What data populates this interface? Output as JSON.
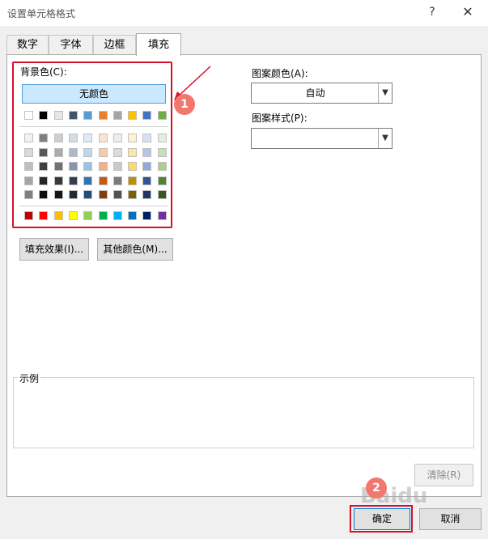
{
  "window": {
    "title": "设置单元格格式",
    "help_label": "?",
    "close_label": "✕"
  },
  "tabs": [
    {
      "label": "数字"
    },
    {
      "label": "字体"
    },
    {
      "label": "边框"
    },
    {
      "label": "填充"
    }
  ],
  "fill": {
    "bg_label": "背景色(C):",
    "no_color_label": "无颜色",
    "theme_row": [
      "#ffffff",
      "#000000",
      "#e7e6e6",
      "#44546a",
      "#5b9bd5",
      "#ed7d31",
      "#a5a5a5",
      "#ffc000",
      "#4472c4",
      "#70ad47"
    ],
    "shade_rows": [
      [
        "#f2f2f2",
        "#7f7f7f",
        "#d0cece",
        "#d6dce4",
        "#ddebf7",
        "#fbe4d5",
        "#ededed",
        "#fff2cc",
        "#d9e1f2",
        "#e2efda"
      ],
      [
        "#d9d9d9",
        "#595959",
        "#aeabab",
        "#adb9ca",
        "#bdd7ee",
        "#f8cbad",
        "#dbdbdb",
        "#ffe699",
        "#b4c6e7",
        "#c6e0b4"
      ],
      [
        "#bfbfbf",
        "#404040",
        "#757171",
        "#8497b0",
        "#9bc2e6",
        "#f4b084",
        "#c9c9c9",
        "#ffd966",
        "#8ea9db",
        "#a9d08e"
      ],
      [
        "#a6a6a6",
        "#262626",
        "#3a3838",
        "#333f4f",
        "#2f75b5",
        "#c65911",
        "#7b7b7b",
        "#bf8f00",
        "#305496",
        "#548235"
      ],
      [
        "#808080",
        "#0d0d0d",
        "#161616",
        "#222b35",
        "#1f4e78",
        "#843c0c",
        "#525252",
        "#7f6000",
        "#203764",
        "#375623"
      ]
    ],
    "standard_row": [
      "#c00000",
      "#ff0000",
      "#ffc000",
      "#ffff00",
      "#92d050",
      "#00b050",
      "#00b0f0",
      "#0070c0",
      "#002060",
      "#7030a0"
    ],
    "fill_effects_label": "填充效果(I)...",
    "more_colors_label": "其他颜色(M)..."
  },
  "pattern": {
    "color_label": "图案颜色(A):",
    "color_value": "自动",
    "style_label": "图案样式(P):",
    "style_value": ""
  },
  "sample": {
    "legend": "示例"
  },
  "buttons": {
    "clear_label": "清除(R)",
    "ok_label": "确定",
    "cancel_label": "取消"
  },
  "annotations": {
    "badge1": "1",
    "badge2": "2",
    "accent_color": "#d4122c",
    "badge_color": "#f2786f"
  },
  "watermark": "Baidu"
}
